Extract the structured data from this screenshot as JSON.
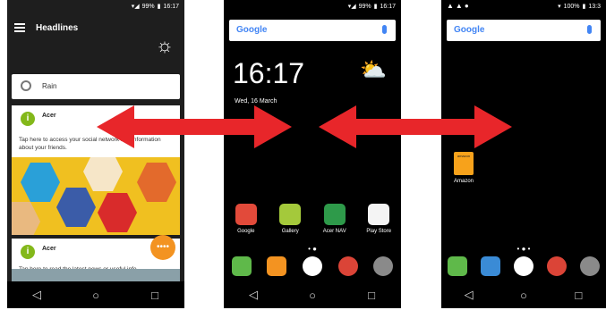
{
  "phone_left": {
    "status_time": "16:17",
    "status_battery": "99%",
    "header_title": "Headlines",
    "rain_label": "Rain",
    "card1_name": "Acer",
    "card1_text": "Tap here to access your social network and information about your friends.",
    "card2_name": "Acer",
    "card2_text": "Tap here to read the latest news or useful info",
    "fab_label": "••••"
  },
  "phone_middle": {
    "status_time": "16:17",
    "status_battery": "99%",
    "search_logo": "Google",
    "clock": "16:17",
    "date": "Wed, 16 March",
    "apps": [
      {
        "label": "Google",
        "icon": "google-app-icon",
        "color": "#e24a3a"
      },
      {
        "label": "Gallery",
        "icon": "gallery-icon",
        "color": "#a4c93b"
      },
      {
        "label": "Acer NAV",
        "icon": "acer-nav-icon",
        "color": "#2e9a4a"
      },
      {
        "label": "Play Store",
        "icon": "play-store-icon",
        "color": "#f4f4f4"
      }
    ],
    "dock": [
      {
        "icon": "phone-icon",
        "color": "#5fb94a"
      },
      {
        "icon": "messaging-icon",
        "color": "#f39321"
      },
      {
        "icon": "app-drawer-icon",
        "color": "#ffffff"
      },
      {
        "icon": "chrome-icon",
        "color": "#db4437"
      },
      {
        "icon": "camera-icon",
        "color": "#8a8a8a"
      }
    ]
  },
  "phone_right": {
    "status_time": "13:3",
    "status_battery": "100%",
    "search_logo": "Google",
    "amazon_label": "Amazon",
    "amazon_icon_text": "amazon",
    "dock": [
      {
        "icon": "phone-icon",
        "color": "#5fb94a"
      },
      {
        "icon": "notes-icon",
        "color": "#3a8bd6"
      },
      {
        "icon": "app-drawer-icon",
        "color": "#ffffff"
      },
      {
        "icon": "chrome-icon",
        "color": "#db4437"
      },
      {
        "icon": "camera-icon",
        "color": "#8a8a8a"
      }
    ]
  },
  "nav": {
    "back": "◁",
    "home": "○",
    "recents": "□"
  },
  "arrow_color": "#e8262a"
}
